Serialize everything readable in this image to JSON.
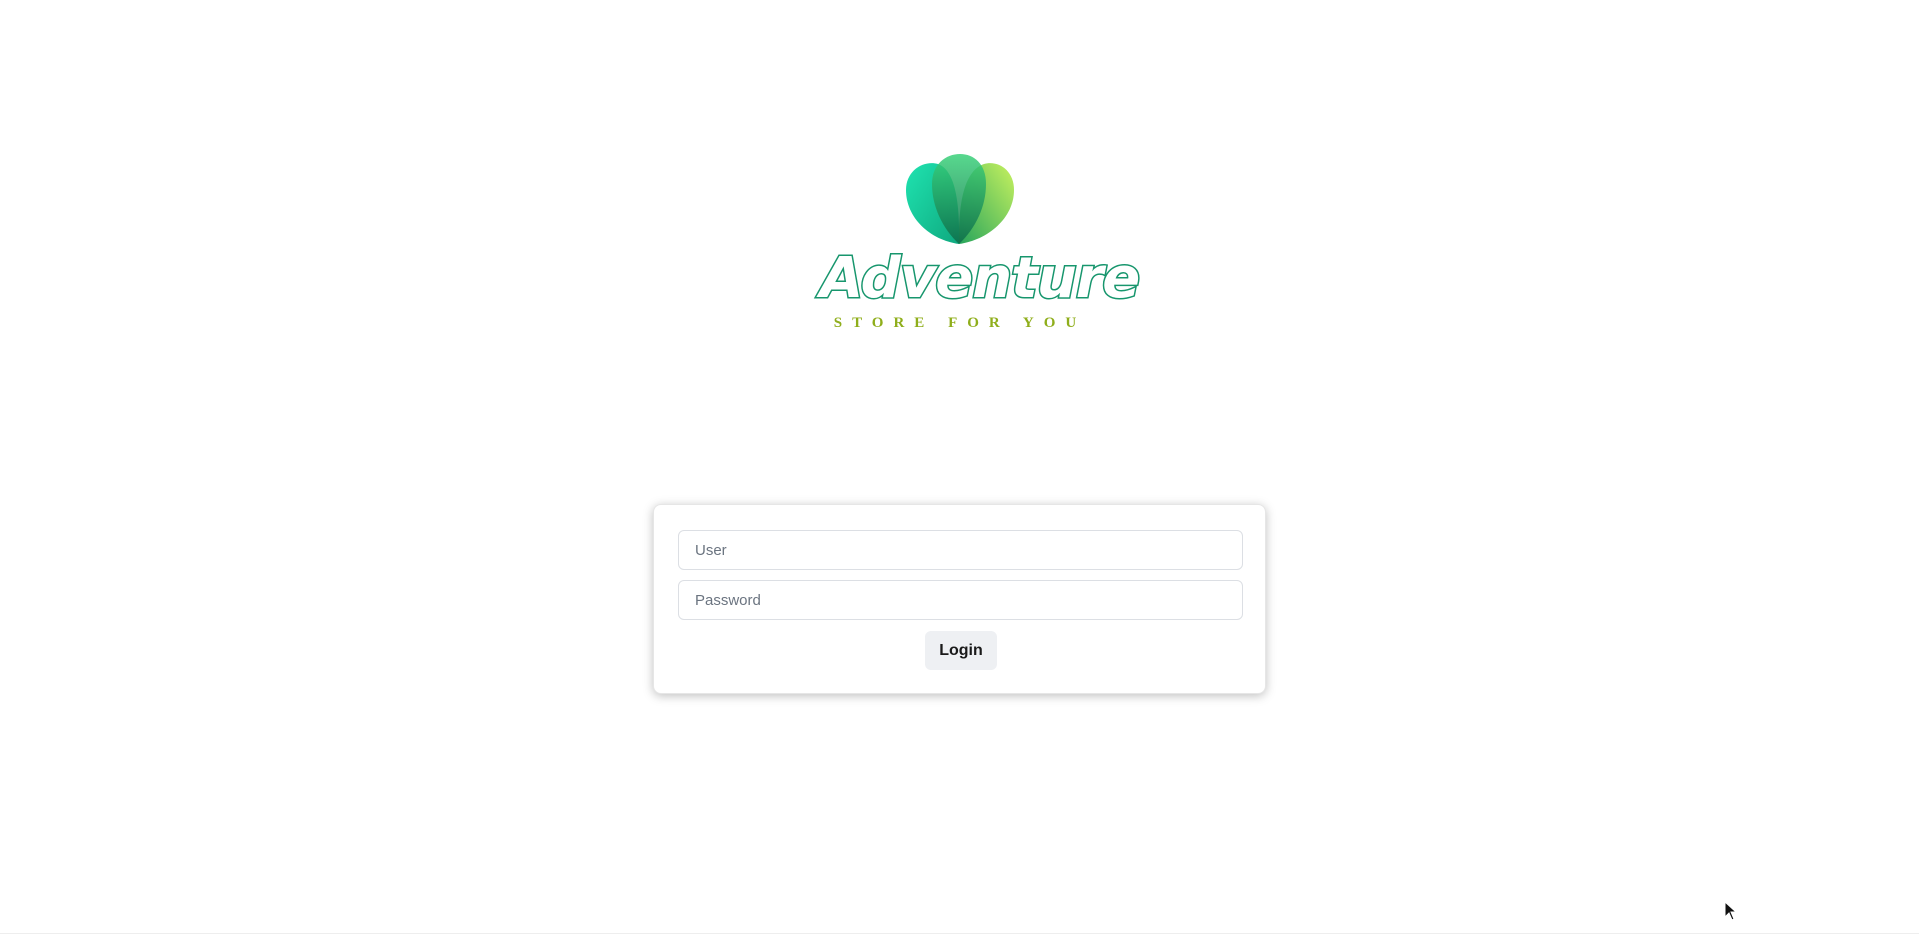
{
  "logo": {
    "icon": "three-leaf-heart-logo",
    "wordmark": "Adventure",
    "tagline": "STORE FOR YOU",
    "colors": {
      "leaf_left": "#19d3a2",
      "leaf_middle": "#1f9f62",
      "leaf_right": "#b8ec54",
      "wordmark_outline": "#17966d",
      "tagline": "#8fae1b"
    }
  },
  "login": {
    "user_placeholder": "User",
    "user_value": "",
    "password_placeholder": "Password",
    "password_value": "",
    "submit_label": "Login"
  },
  "cursor": {
    "icon": "mouse-pointer-icon"
  }
}
